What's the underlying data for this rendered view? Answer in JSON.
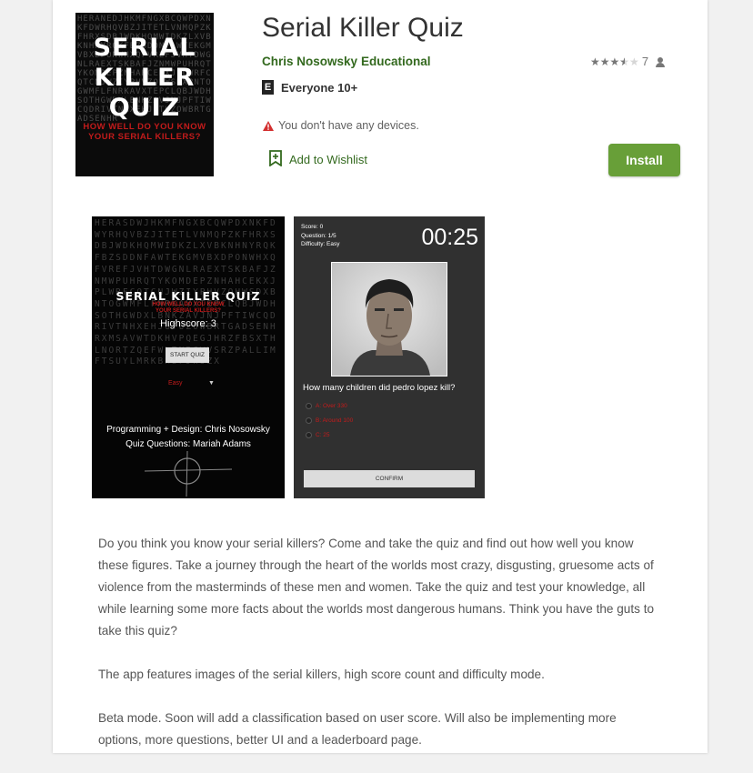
{
  "app": {
    "title": "Serial Killer Quiz",
    "developer": "Chris Nosowsky",
    "category": "Educational",
    "rating_value": 3.5,
    "rating_count": "7",
    "content_rating": "Everyone 10+",
    "content_rating_badge": "E",
    "device_warning": "You don't have any devices.",
    "wishlist_label": "Add to Wishlist",
    "install_label": "Install"
  },
  "icon": {
    "title_line1": "SERIAL",
    "title_line2": "KILLER",
    "title_line3": "QUIZ",
    "subtitle_line1": "HOW WELL DO YOU KNOW",
    "subtitle_line2": "YOUR SERIAL KILLERS?",
    "rain": "HERANEDJHKMFNGXBCQWPDXNKFDWRHQVBZJITETLVNMQPZKFHRXSDBJWDKHQMWIDKZLXVBKNHNYRQKFBZSDDNFAWTEKGMVBXDPONWHXQFVREFJVHTDWGNLRAEXTSKBAFJZNMWPUHRQTYKOMDEPZNHAHCEKXJPLWRFCQTCNJWZIYPHVZQHWSDXBNTOGWMFLFNRKAVXTEPCLQBJWDHSOTHGWDXLBNKZAVJNJPFTIWCQDRIVTNHXEHJUTUZOWBRTGADSENHR"
  },
  "screenshot1": {
    "title": "SERIAL KILLER QUIZ",
    "subtitle_line1": "HOW WELL DO YOU KNOW",
    "subtitle_line2": "YOUR SERIAL KILLERS?",
    "highscore": "Highscore: 3",
    "start_label": "START QUIZ",
    "difficulty": "Easy",
    "credit1": "Programming + Design: Chris Nosowsky",
    "credit2": "Quiz Questions: Mariah Adams",
    "rain": "HERASDWJHKMFNGXBCQWPDXNKFDWYRHQVBZJITETLVNMQPZKFHRXSDBJWDKHQMWIDKZLXVBKNHNYRQKFBZSDDNFAWTEKGMVBXDPONWHXQFVREFJVHTDWGNLRAEXTSKBAFJZNMWPUHRQTYKOMDEPZNHAHCEKXJPLWRFCQTCNJWZIYPHVZQHWSDXBNTOGWMFLFNRKAVXTEPCLQBJWDHSOTHGWDXLBNKZAVJNJPFTIWCQDRIVTNHXEHJUTUZOWBRTGADSENHRXMSAVWTDKHVPQEGJHRZFBSXTHLNORTZQEFWLTNBGWVSRZPALLIMFTSUYLMRKBHBFJWSZX"
  },
  "screenshot2": {
    "score": "Score: 0",
    "question_num": "Question: 1/5",
    "difficulty": "Difficulty: Easy",
    "timer": "00:25",
    "question": "How many children did pedro lopez kill?",
    "options": [
      "A: Over 330",
      "B: Around 100",
      "C: 25"
    ],
    "confirm_label": "CONFIRM"
  },
  "description": {
    "p1": "Do you think you know your serial killers? Come and take the quiz and find out how well you know these figures. Take a journey through the heart of the worlds most crazy, disgusting, gruesome acts of violence from the masterminds of these men and women. Take the quiz and test your knowledge, all while learning some more facts about the worlds most dangerous humans. Think you have the guts to take this quiz?",
    "p2": "The app features images of the serial killers, high score count and difficulty mode.",
    "p3": "Beta mode. Soon will add a classification based on user score. Will also be implementing more options, more questions, better UI and a leaderboard page."
  },
  "colors": {
    "accent_green": "#33691e",
    "install_green": "#689f38",
    "quiz_red": "#c21b1b"
  }
}
